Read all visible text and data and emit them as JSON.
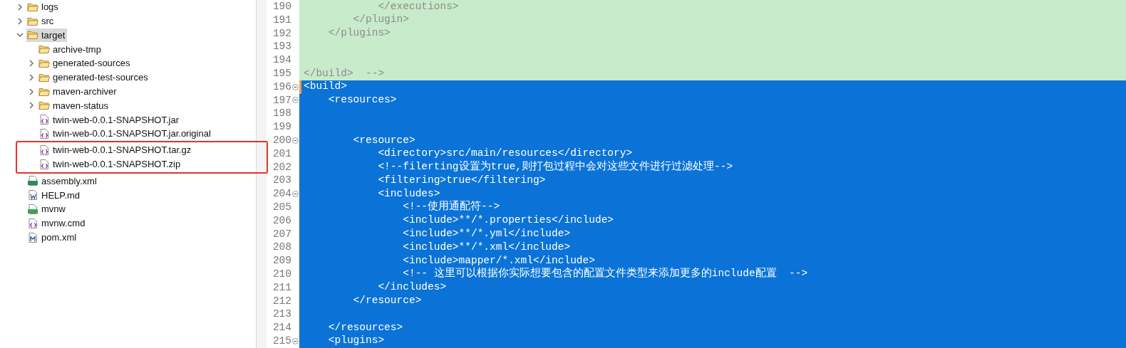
{
  "project_tree": [
    {
      "label": "logs",
      "kind": "folder",
      "expanded": false,
      "selected": false
    },
    {
      "label": "src",
      "kind": "folder",
      "expanded": false,
      "selected": false
    },
    {
      "label": "target",
      "kind": "folder",
      "expanded": true,
      "selected": true,
      "children": [
        {
          "label": "archive-tmp",
          "kind": "leaf-folder",
          "selected": false
        },
        {
          "label": "generated-sources",
          "kind": "folder",
          "expanded": false,
          "selected": false
        },
        {
          "label": "generated-test-sources",
          "kind": "folder",
          "expanded": false,
          "selected": false
        },
        {
          "label": "maven-archiver",
          "kind": "folder",
          "expanded": false,
          "selected": false
        },
        {
          "label": "maven-status",
          "kind": "folder",
          "expanded": false,
          "selected": false
        },
        {
          "label": "twin-web-0.0.1-SNAPSHOT.jar",
          "kind": "file",
          "selected": false
        },
        {
          "label": "twin-web-0.0.1-SNAPSHOT.jar.original",
          "kind": "file",
          "selected": false
        },
        {
          "label": "twin-web-0.0.1-SNAPSHOT.tar.gz",
          "kind": "file",
          "selected": false,
          "marked": true
        },
        {
          "label": "twin-web-0.0.1-SNAPSHOT.zip",
          "kind": "file",
          "selected": false,
          "marked": true
        }
      ]
    },
    {
      "label": "assembly.xml",
      "kind": "xml",
      "selected": false
    },
    {
      "label": "HELP.md",
      "kind": "doc",
      "selected": false
    },
    {
      "label": "mvnw",
      "kind": "shell",
      "selected": false
    },
    {
      "label": "mvnw.cmd",
      "kind": "file",
      "selected": false
    },
    {
      "label": "pom.xml",
      "kind": "maven",
      "selected": false
    }
  ],
  "editor": {
    "lines": [
      {
        "number": "190",
        "text": "            </executions>",
        "selected": false,
        "commented": true,
        "foldable": false
      },
      {
        "number": "191",
        "text": "        </plugin>",
        "selected": false,
        "commented": true,
        "foldable": false
      },
      {
        "number": "192",
        "text": "    </plugins>",
        "selected": false,
        "commented": true,
        "foldable": false
      },
      {
        "number": "193",
        "selected": false,
        "commented": true,
        "foldable": false
      },
      {
        "number": "194",
        "selected": false,
        "commented": true,
        "foldable": false
      },
      {
        "number": "195",
        "text": "</build>  -->",
        "selected": false,
        "commented": true,
        "foldable": false
      },
      {
        "number": "196",
        "text": "<build>",
        "selected": true,
        "commented": false,
        "foldable": true
      },
      {
        "number": "197",
        "text": "    <resources>",
        "selected": true,
        "commented": false,
        "foldable": true
      },
      {
        "number": "198",
        "selected": true,
        "commented": false,
        "foldable": false
      },
      {
        "number": "199",
        "selected": true,
        "commented": false,
        "foldable": false
      },
      {
        "number": "200",
        "text": "        <resource>",
        "selected": true,
        "commented": false,
        "foldable": true
      },
      {
        "number": "201",
        "text": "            <directory>src/main/resources</directory>",
        "selected": true,
        "commented": false,
        "foldable": false
      },
      {
        "number": "202",
        "text": "            <!--filerting设置为true,则打包过程中会对这些文件进行过滤处理-->",
        "selected": true,
        "commented": false,
        "foldable": false
      },
      {
        "number": "203",
        "text": "            <filtering>true</filtering>",
        "selected": true,
        "commented": false,
        "foldable": false
      },
      {
        "number": "204",
        "text": "            <includes>",
        "selected": true,
        "commented": false,
        "foldable": true
      },
      {
        "number": "205",
        "text": "                <!--使用通配符-->",
        "selected": true,
        "commented": false,
        "foldable": false
      },
      {
        "number": "206",
        "text": "                <include>**/*.properties</include>",
        "selected": true,
        "commented": false,
        "foldable": false
      },
      {
        "number": "207",
        "text": "                <include>**/*.yml</include>",
        "selected": true,
        "commented": false,
        "foldable": false
      },
      {
        "number": "208",
        "text": "                <include>**/*.xml</include>",
        "selected": true,
        "commented": false,
        "foldable": false
      },
      {
        "number": "209",
        "text": "                <include>mapper/*.xml</include>",
        "selected": true,
        "commented": false,
        "foldable": false
      },
      {
        "number": "210",
        "text": "                <!-- 这里可以根据你实际想要包含的配置文件类型来添加更多的include配置  -->",
        "selected": true,
        "commented": false,
        "foldable": false
      },
      {
        "number": "211",
        "text": "            </includes>",
        "selected": true,
        "commented": false,
        "foldable": false
      },
      {
        "number": "212",
        "text": "        </resource>",
        "selected": true,
        "commented": false,
        "foldable": false
      },
      {
        "number": "213",
        "selected": true,
        "commented": false,
        "foldable": false
      },
      {
        "number": "214",
        "text": "    </resources>",
        "selected": true,
        "commented": false,
        "foldable": false
      },
      {
        "number": "215",
        "text": "    <plugins>",
        "selected": true,
        "commented": false,
        "foldable": true
      }
    ]
  }
}
